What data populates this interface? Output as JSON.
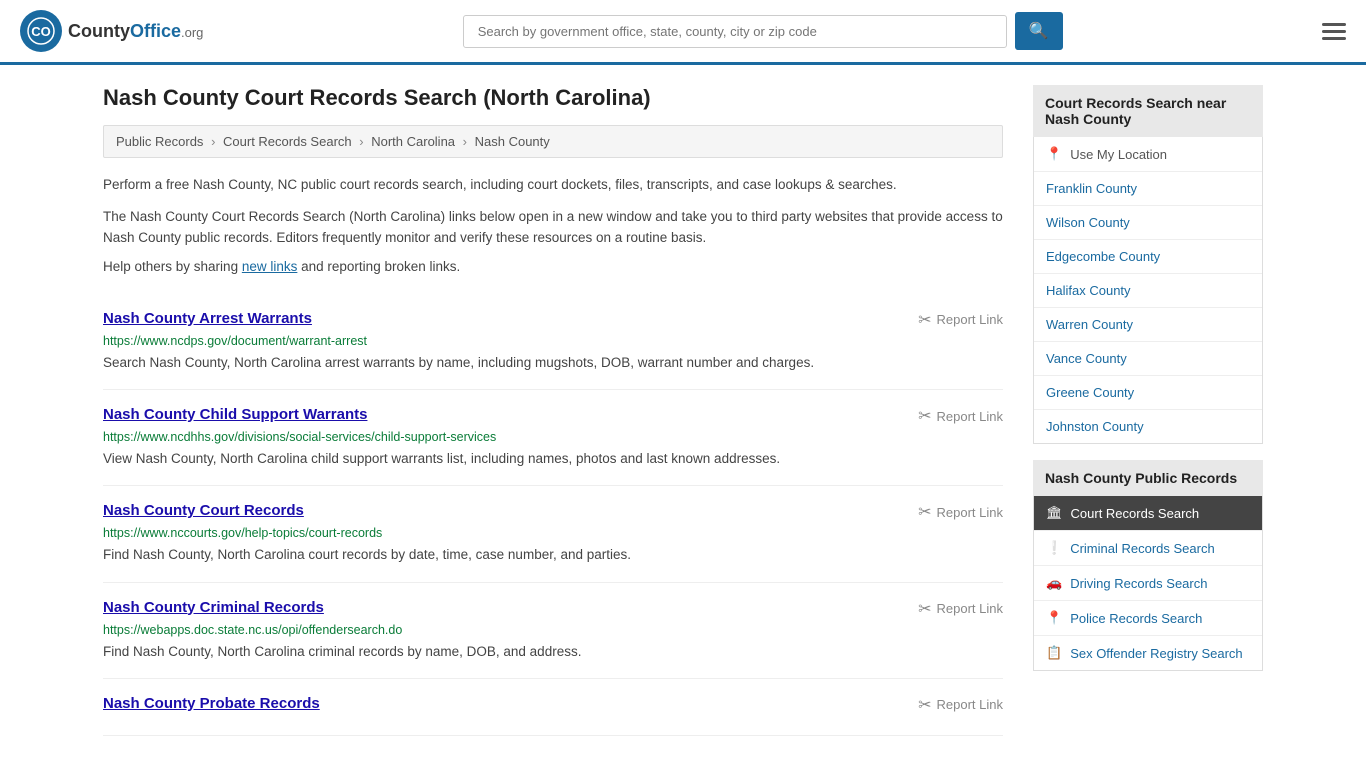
{
  "header": {
    "logo_symbol": "✦",
    "logo_name": "County",
    "logo_ext": "Office",
    "logo_org": ".org",
    "search_placeholder": "Search by government office, state, county, city or zip code",
    "search_btn_icon": "🔍"
  },
  "page": {
    "title": "Nash County Court Records Search (North Carolina)",
    "breadcrumbs": [
      {
        "label": "Public Records",
        "href": "#"
      },
      {
        "label": "Court Records Search",
        "href": "#"
      },
      {
        "label": "North Carolina",
        "href": "#"
      },
      {
        "label": "Nash County",
        "href": "#"
      }
    ],
    "intro1": "Perform a free Nash County, NC public court records search, including court dockets, files, transcripts, and case lookups & searches.",
    "intro2": "The Nash County Court Records Search (North Carolina) links below open in a new window and take you to third party websites that provide access to Nash County public records. Editors frequently monitor and verify these resources on a routine basis.",
    "help_text": "Help others by sharing",
    "help_link": "new links",
    "help_text2": "and reporting broken links."
  },
  "results": [
    {
      "title": "Nash County Arrest Warrants",
      "url": "https://www.ncdps.gov/document/warrant-arrest",
      "desc": "Search Nash County, North Carolina arrest warrants by name, including mugshots, DOB, warrant number and charges.",
      "report_label": "Report Link"
    },
    {
      "title": "Nash County Child Support Warrants",
      "url": "https://www.ncdhhs.gov/divisions/social-services/child-support-services",
      "desc": "View Nash County, North Carolina child support warrants list, including names, photos and last known addresses.",
      "report_label": "Report Link"
    },
    {
      "title": "Nash County Court Records",
      "url": "https://www.nccourts.gov/help-topics/court-records",
      "desc": "Find Nash County, North Carolina court records by date, time, case number, and parties.",
      "report_label": "Report Link"
    },
    {
      "title": "Nash County Criminal Records",
      "url": "https://webapps.doc.state.nc.us/opi/offendersearch.do",
      "desc": "Find Nash County, North Carolina criminal records by name, DOB, and address.",
      "report_label": "Report Link"
    },
    {
      "title": "Nash County Probate Records",
      "url": "",
      "desc": "",
      "report_label": "Report Link"
    }
  ],
  "sidebar": {
    "nearby_header": "Court Records Search near Nash County",
    "nearby_items": [
      {
        "label": "Use My Location",
        "icon": "📍",
        "type": "location"
      },
      {
        "label": "Franklin County",
        "icon": "",
        "type": "county"
      },
      {
        "label": "Wilson County",
        "icon": "",
        "type": "county"
      },
      {
        "label": "Edgecombe County",
        "icon": "",
        "type": "county"
      },
      {
        "label": "Halifax County",
        "icon": "",
        "type": "county"
      },
      {
        "label": "Warren County",
        "icon": "",
        "type": "county"
      },
      {
        "label": "Vance County",
        "icon": "",
        "type": "county"
      },
      {
        "label": "Greene County",
        "icon": "",
        "type": "county"
      },
      {
        "label": "Johnston County",
        "icon": "",
        "type": "county"
      }
    ],
    "public_records_header": "Nash County Public Records",
    "public_records_items": [
      {
        "label": "Court Records Search",
        "icon": "🏛",
        "active": true
      },
      {
        "label": "Criminal Records Search",
        "icon": "❗",
        "active": false
      },
      {
        "label": "Driving Records Search",
        "icon": "🚗",
        "active": false
      },
      {
        "label": "Police Records Search",
        "icon": "📍",
        "active": false
      },
      {
        "label": "Sex Offender Registry Search",
        "icon": "📋",
        "active": false
      }
    ]
  }
}
